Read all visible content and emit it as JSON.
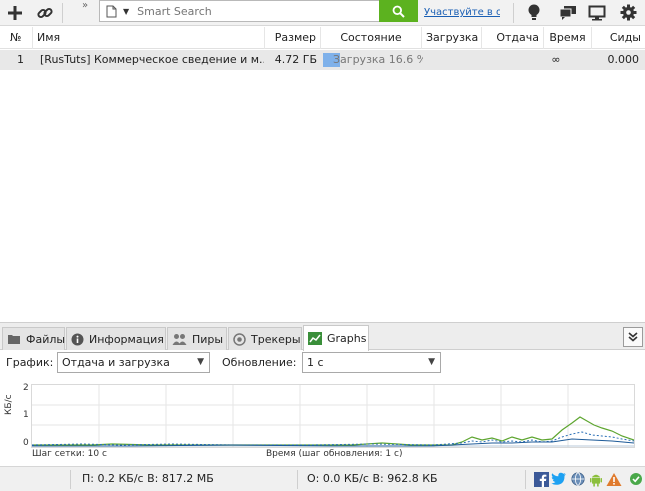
{
  "toolbar": {
    "add_icon": "plus-icon",
    "link_icon": "link-icon",
    "more_label": "»",
    "search_placeholder": "Smart Search",
    "promo_text": "Участвуйте в опросе",
    "icons": [
      "lightbulb-icon",
      "chat-icon",
      "monitor-icon",
      "gear-icon"
    ]
  },
  "table": {
    "columns": [
      "№",
      "Имя",
      "Размер",
      "Состояние",
      "Загрузка",
      "Отдача",
      "Время",
      "Сиды"
    ],
    "rows": [
      {
        "num": "1",
        "name": "[RusTuts] Коммерческое сведение и м...",
        "size": "4.72 ГБ",
        "state": "Загрузка 16.6 %",
        "progress": 0.166,
        "download": "",
        "upload": "",
        "time": "∞",
        "seeds": "0.000"
      }
    ]
  },
  "tabs": [
    {
      "label": "Файлы",
      "icon": "files-icon",
      "active": false
    },
    {
      "label": "Информация",
      "icon": "info-icon",
      "active": false
    },
    {
      "label": "Пиры",
      "icon": "peers-icon",
      "active": false
    },
    {
      "label": "Трекеры",
      "icon": "trackers-icon",
      "active": false
    },
    {
      "label": "Graphs",
      "icon": "graph-icon",
      "active": true
    }
  ],
  "graph_controls": {
    "graph_label": "График:",
    "graph_value": "Отдача и загрузка",
    "update_label": "Обновление:",
    "update_value": "1 с"
  },
  "graph": {
    "y_ticks": [
      "2",
      "1",
      "0"
    ],
    "y_unit": "КБ/с",
    "grid_step": "Шаг сетки: 10 с",
    "time_label": "Время (шаг обновления: 1 с)",
    "colors": {
      "download": "#5da52f",
      "upload": "#2a6fb6",
      "grid": "#e6e6e6"
    }
  },
  "status": {
    "download_text": "П: 0.2 КБ/с В: 817.2 МБ",
    "upload_text": "О: 0.0 КБ/с В: 962.8 КБ",
    "icons": [
      "facebook-icon",
      "twitter-icon",
      "globe-icon",
      "android-icon",
      "warning-icon"
    ]
  }
}
